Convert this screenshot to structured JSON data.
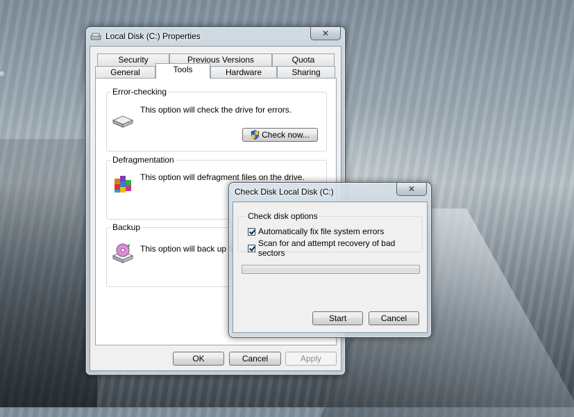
{
  "desktop": {
    "edge_text": "e"
  },
  "properties_window": {
    "title": "Local Disk (C:) Properties",
    "close_label": "✕",
    "tabs_row_back": [
      "Security",
      "Previous Versions",
      "Quota"
    ],
    "tabs_row_front": [
      "General",
      "Tools",
      "Hardware",
      "Sharing"
    ],
    "active_tab": "Tools",
    "error_checking": {
      "label": "Error-checking",
      "description": "This option will check the drive for errors.",
      "button": "Check now..."
    },
    "defragmentation": {
      "label": "Defragmentation",
      "description": "This option will defragment files on the drive."
    },
    "backup": {
      "label": "Backup",
      "description": "This option will back up files"
    },
    "buttons": {
      "ok": "OK",
      "cancel": "Cancel",
      "apply": "Apply"
    }
  },
  "check_disk_dialog": {
    "title": "Check Disk Local Disk (C:)",
    "close_label": "✕",
    "group_label": "Check disk options",
    "options": [
      {
        "label": "Automatically fix file system errors",
        "checked": true
      },
      {
        "label": "Scan for and attempt recovery of bad sectors",
        "checked": true
      }
    ],
    "progress": 0,
    "buttons": {
      "start": "Start",
      "cancel": "Cancel"
    }
  },
  "colors": {
    "accent": "#1c5180",
    "window_glass": "#c7d2da",
    "dialog_bg": "#f0f0f0"
  }
}
